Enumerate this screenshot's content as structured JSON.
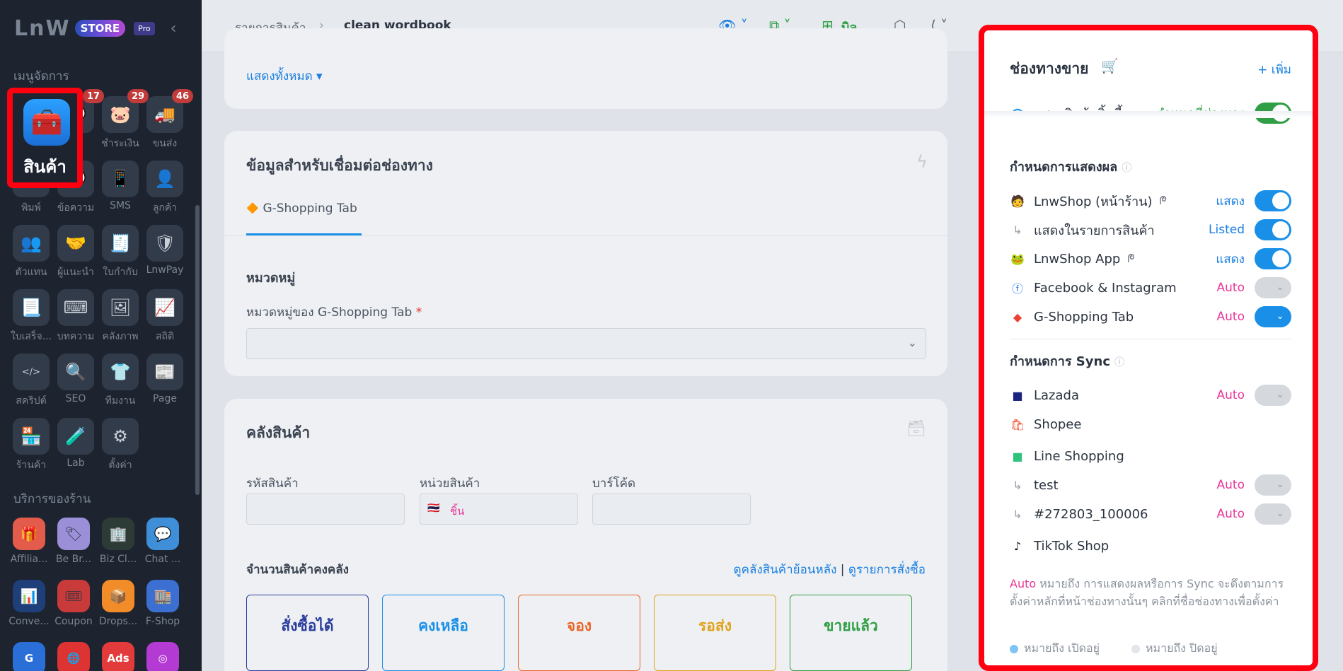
{
  "brand": {
    "logo": "LnW",
    "store": "STORE",
    "pro": "Pro"
  },
  "sidebar": {
    "menu_heading": "เมนูจัดการ",
    "service_heading": "บริการของร้าน",
    "highlight_label": "สินค้า",
    "items": [
      {
        "label": "สินค้า",
        "badge": ""
      },
      {
        "label": "",
        "badge": "17"
      },
      {
        "label": "ชำระเงิน",
        "badge": "29"
      },
      {
        "label": "ขนส่ง",
        "badge": "46"
      },
      {
        "label": "พิมพ์",
        "badge": ""
      },
      {
        "label": "ข้อความ",
        "badge": ""
      },
      {
        "label": "SMS",
        "badge": ""
      },
      {
        "label": "ลูกค้า",
        "badge": ""
      },
      {
        "label": "ตัวแทน",
        "badge": ""
      },
      {
        "label": "ผู้แนะนำ",
        "badge": ""
      },
      {
        "label": "ใบกำกับ",
        "badge": ""
      },
      {
        "label": "LnwPay",
        "badge": ""
      },
      {
        "label": "ใบเสร็จ...",
        "badge": ""
      },
      {
        "label": "บทความ",
        "badge": ""
      },
      {
        "label": "คลังภาพ",
        "badge": ""
      },
      {
        "label": "สถิติ",
        "badge": ""
      },
      {
        "label": "สคริปต์",
        "badge": ""
      },
      {
        "label": "SEO",
        "badge": ""
      },
      {
        "label": "ทีมงาน",
        "badge": ""
      },
      {
        "label": "Page",
        "badge": ""
      },
      {
        "label": "ร้านค้า",
        "badge": ""
      },
      {
        "label": "Lab",
        "badge": ""
      },
      {
        "label": "ตั้งค่า",
        "badge": ""
      }
    ],
    "services": [
      {
        "label": "Affilia..."
      },
      {
        "label": "Be Br..."
      },
      {
        "label": "Biz Cl..."
      },
      {
        "label": "Chat ..."
      },
      {
        "label": "Conve..."
      },
      {
        "label": "Coupon"
      },
      {
        "label": "Drops..."
      },
      {
        "label": "F-Shop"
      }
    ]
  },
  "topbar": {
    "breadcrumb_root": "รายการสินค้า",
    "breadcrumb_current": "clean wordbook",
    "bill_label": "บิล"
  },
  "main": {
    "show_all": "แสดงทั้งหมด ▾",
    "connect_title": "ข้อมูลสำหรับเชื่อมต่อช่องทาง",
    "tab_label": "G-Shopping Tab",
    "category_heading": "หมวดหมู่",
    "category_label": "หมวดหมู่ของ G-Shopping Tab",
    "required_mark": "*",
    "warehouse_title": "คลังสินค้า",
    "sku_label": "รหัสสินค้า",
    "unit_label": "หน่วยสินค้า",
    "unit_value": "ชิ้น",
    "barcode_label": "บาร์โค้ด",
    "stock_heading": "จำนวนสินค้าคงคลัง",
    "stock_history": "ดูคลังสินค้าย้อนหลัง",
    "stock_sep": "|",
    "order_list": "ดูรายการสั่งซื้อ",
    "stats": [
      {
        "label": "สั่งซื้อได้",
        "color": "#2a3d9e"
      },
      {
        "label": "คงเหลือ",
        "color": "#1a8fe8"
      },
      {
        "label": "จอง",
        "color": "#e8672b"
      },
      {
        "label": "รอส่ง",
        "color": "#e0a21a"
      },
      {
        "label": "ขายแล้ว",
        "color": "#2f9e44"
      }
    ]
  },
  "panel": {
    "title": "ช่องทางขาย",
    "add_label": "+ เพิ่ม",
    "show_product": "แสดงสินค้าชิ้นนี้",
    "show_product_status": "กำหนดที่ช่องทาง",
    "display_heading": "กำหนดการแสดงผล",
    "sync_heading": "กำหนดการ Sync",
    "display_rows": [
      {
        "icon": "lnwshop-icon",
        "name": "LnwShop (หน้าร้าน)",
        "extra": "ᖘ",
        "status": "แสดง",
        "status_color": "blue",
        "toggle": "on"
      },
      {
        "icon": "sub-arrow-icon",
        "name": "แสดงในรายการสินค้า",
        "extra": "",
        "status": "Listed",
        "status_color": "blue",
        "toggle": "on"
      },
      {
        "icon": "lnwshop-app-icon",
        "name": "LnwShop App",
        "extra": "ᖘ",
        "status": "แสดง",
        "status_color": "blue",
        "toggle": "on"
      },
      {
        "icon": "facebook-icon",
        "name": "Facebook & Instagram",
        "extra": "",
        "status": "Auto",
        "status_color": "pink",
        "toggle": "off"
      },
      {
        "icon": "google-icon",
        "name": "G-Shopping Tab",
        "extra": "",
        "status": "Auto",
        "status_color": "pink",
        "toggle": "on-chev"
      }
    ],
    "sync_rows": [
      {
        "icon": "lazada-icon",
        "name": "Lazada",
        "status": "Auto",
        "toggle": "off"
      },
      {
        "icon": "shopee-icon",
        "name": "Shopee",
        "status": "",
        "toggle": ""
      },
      {
        "icon": "line-shopping-icon",
        "name": "Line Shopping",
        "status": "",
        "toggle": ""
      },
      {
        "icon": "sub-arrow-icon",
        "name": "test",
        "status": "Auto",
        "toggle": "off"
      },
      {
        "icon": "sub-arrow-icon",
        "name": "#272803_100006",
        "status": "Auto",
        "toggle": "off"
      },
      {
        "icon": "tiktok-icon",
        "name": "TikTok Shop",
        "status": "",
        "toggle": ""
      }
    ],
    "note_auto": "Auto",
    "note_text": " หมายถึง การแสดงผลหรือการ Sync จะดึงตามการตั้งค่าหลักที่หน้าช่องทางนั้นๆ คลิกที่ชื่อช่องทางเพื่อตั้งค่า",
    "legend_on": "หมายถึง เปิดอยู่",
    "legend_off": "หมายถึง ปิดอยู่",
    "colors": {
      "blue": "#1a7fe0",
      "pink": "#e8369a",
      "green": "#2f9e44",
      "off": "#d5d9de"
    }
  }
}
